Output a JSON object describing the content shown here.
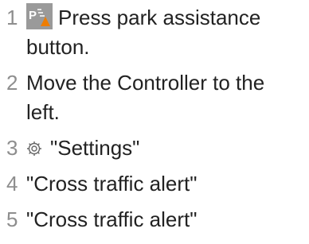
{
  "steps": [
    {
      "number": "1",
      "icon": "park-assist-icon",
      "lines": [
        "Press park assistance",
        "button."
      ]
    },
    {
      "number": "2",
      "lines": [
        "Move the Controller to the",
        "left."
      ]
    },
    {
      "number": "3",
      "icon": "gear-icon",
      "lines": [
        "\"Settings\""
      ]
    },
    {
      "number": "4",
      "lines": [
        "\"Cross traffic alert\""
      ]
    },
    {
      "number": "5",
      "lines": [
        "\"Cross traffic alert\""
      ]
    }
  ],
  "colors": {
    "text": "#222222",
    "step_number": "#8e8e8e",
    "park_icon_bg": "#9a9a9a",
    "park_icon_accent": "#ef7d00"
  }
}
